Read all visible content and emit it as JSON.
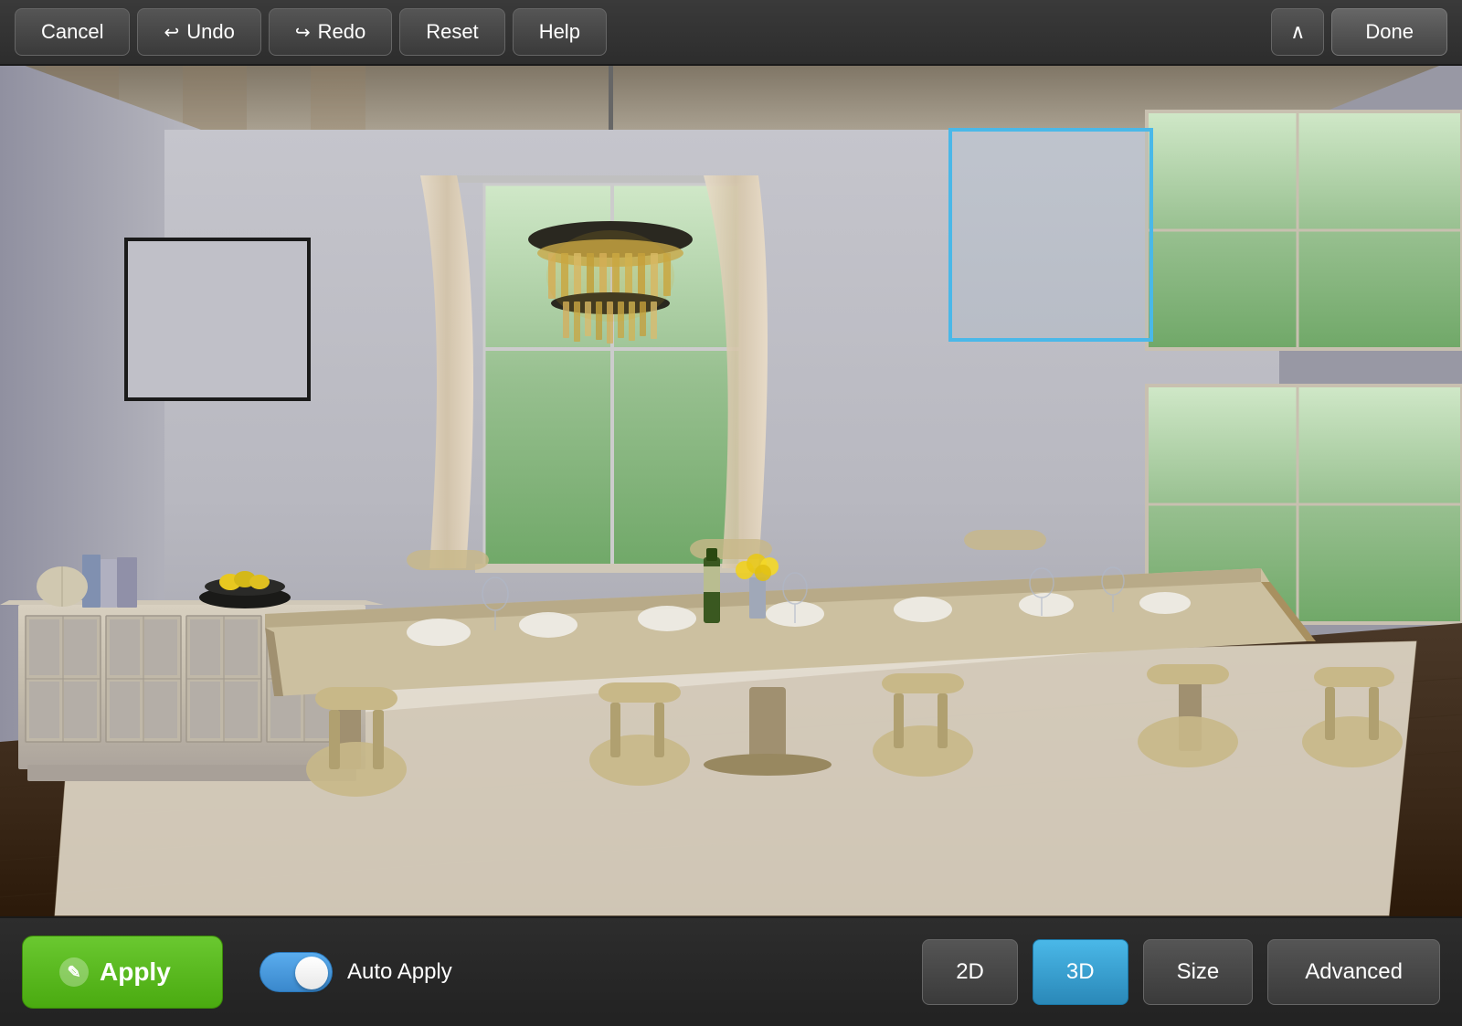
{
  "toolbar": {
    "cancel_label": "Cancel",
    "undo_label": "Undo",
    "redo_label": "Redo",
    "reset_label": "Reset",
    "help_label": "Help",
    "done_label": "Done",
    "chevron_symbol": "∧"
  },
  "bottom_toolbar": {
    "apply_label": "Apply",
    "apply_icon": "✎",
    "auto_apply_label": "Auto Apply",
    "view_2d_label": "2D",
    "view_3d_label": "3D",
    "size_label": "Size",
    "advanced_label": "Advanced"
  },
  "scene": {
    "selection_visible": true
  }
}
